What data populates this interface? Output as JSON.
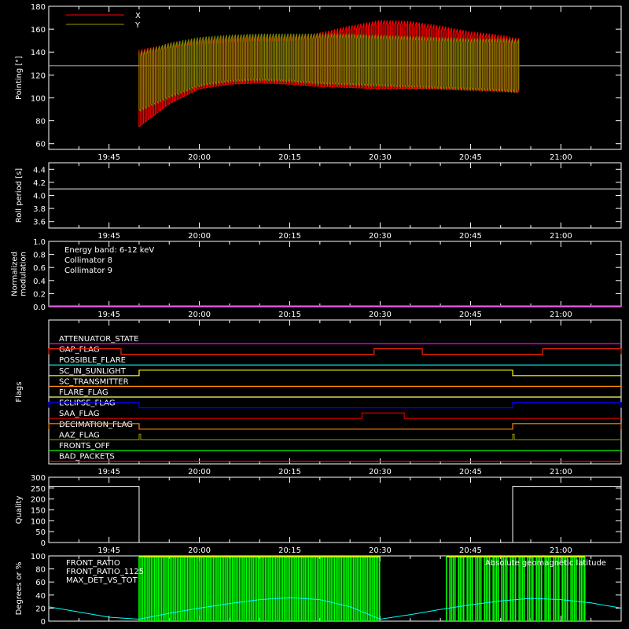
{
  "colors": {
    "background": "#000000",
    "axis": "#ffffff",
    "x_series": "#ff0000",
    "y_series": "#808000"
  },
  "chart_data": [
    {
      "type": "line",
      "ylabel": "Pointing [\"]",
      "ylim": [
        55,
        180
      ],
      "yticks": [
        "60",
        "80",
        "100",
        "120",
        "140",
        "160",
        "180"
      ],
      "xticks": [
        "19:45",
        "20:00",
        "20:15",
        "20:30",
        "20:45",
        "21:00"
      ],
      "xlim": [
        "19:35",
        "21:10"
      ],
      "legend": [
        "X",
        "Y"
      ],
      "legend_colors": [
        "#ff0000",
        "#999900"
      ],
      "reference_line": 128,
      "data_span": [
        "19:50",
        "20:53"
      ],
      "series": [
        {
          "name": "X",
          "color": "#ff0000",
          "time": [
            "19:50",
            "19:55",
            "20:00",
            "20:05",
            "20:10",
            "20:15",
            "20:20",
            "20:25",
            "20:30",
            "20:35",
            "20:40",
            "20:45",
            "20:50",
            "20:53"
          ],
          "upper": [
            142,
            147,
            150,
            152,
            153,
            153,
            157,
            163,
            168,
            167,
            163,
            158,
            155,
            152
          ],
          "lower": [
            75,
            95,
            108,
            112,
            113,
            112,
            110,
            109,
            108,
            108,
            108,
            107,
            106,
            105
          ]
        },
        {
          "name": "Y",
          "color": "#808000",
          "time": [
            "19:50",
            "19:55",
            "20:00",
            "20:05",
            "20:10",
            "20:15",
            "20:20",
            "20:25",
            "20:30",
            "20:35",
            "20:40",
            "20:45",
            "20:50",
            "20:53"
          ],
          "upper": [
            140,
            148,
            153,
            155,
            156,
            156,
            156,
            156,
            155,
            154,
            153,
            152,
            152,
            151
          ],
          "lower": [
            88,
            100,
            110,
            114,
            115,
            114,
            112,
            111,
            110,
            109,
            108,
            107,
            106,
            105
          ]
        }
      ]
    },
    {
      "type": "line",
      "ylabel": "Roll period [s]",
      "ylim": [
        3.5,
        4.5
      ],
      "yticks": [
        "3.6",
        "3.8",
        "4.0",
        "4.2",
        "4.4"
      ],
      "xticks": [
        "19:45",
        "20:00",
        "20:15",
        "20:30",
        "20:45",
        "21:00"
      ],
      "series": [
        {
          "color": "#ffffff",
          "time": [
            "19:35",
            "21:10"
          ],
          "values": [
            4.1,
            4.1
          ]
        }
      ]
    },
    {
      "type": "line",
      "ylabel": "Normalized modulation",
      "ylim": [
        0,
        1.0
      ],
      "yticks": [
        "0.0",
        "0.2",
        "0.4",
        "0.6",
        "0.8",
        "1.0"
      ],
      "xticks": [
        "19:45",
        "20:00",
        "20:15",
        "20:30",
        "20:45",
        "21:00"
      ],
      "annotations": [
        {
          "text": "Energy band: 6-12 keV",
          "color": "#ffffff"
        },
        {
          "text": "Collimator 8",
          "color": "#00ffff"
        },
        {
          "text": "Collimator 9",
          "color": "#ff00ff"
        }
      ],
      "series": [
        {
          "color": "#ff00ff",
          "time": [
            "19:35",
            "21:10"
          ],
          "values": [
            0,
            0
          ]
        }
      ]
    },
    {
      "type": "line",
      "ylabel": "Flags",
      "xticks": [
        "19:45",
        "20:00",
        "20:15",
        "20:30",
        "20:45",
        "21:00"
      ],
      "flags": [
        {
          "name": "ATTENUATOR_STATE",
          "color": "#ff00ff",
          "high": []
        },
        {
          "name": "GAP_FLAG",
          "color": "#ff2200",
          "high": [
            [
              "19:35",
              "19:47"
            ],
            [
              "20:29",
              "20:37"
            ],
            [
              "20:57",
              "21:10"
            ]
          ]
        },
        {
          "name": "POSSIBLE_FLARE",
          "color": "#00ffff",
          "high": []
        },
        {
          "name": "SC_IN_SUNLIGHT",
          "color": "#ffff00",
          "high": [
            [
              "19:50",
              "20:52"
            ]
          ]
        },
        {
          "name": "SC_TRANSMITTER",
          "color": "#ff8800",
          "high": []
        },
        {
          "name": "FLARE_FLAG",
          "color": "#ffff66",
          "high": []
        },
        {
          "name": "ECLIPSE_FLAG",
          "color": "#0000ff",
          "high": [
            [
              "19:35",
              "19:50"
            ],
            [
              "20:52",
              "21:10"
            ]
          ]
        },
        {
          "name": "SAA_FLAG",
          "color": "#dd0000",
          "high": [
            [
              "20:27",
              "20:34"
            ]
          ]
        },
        {
          "name": "DECIMATION_FLAG",
          "color": "#ff8800",
          "high": [
            [
              "19:35",
              "19:50"
            ],
            [
              "20:52",
              "21:10"
            ]
          ]
        },
        {
          "name": "AAZ_FLAG",
          "color": "#808000",
          "high": [
            [
              "19:50",
              "19:50"
            ],
            [
              "20:52",
              "20:52"
            ]
          ]
        },
        {
          "name": "FRONTS_OFF",
          "color": "#00ff00",
          "high": []
        },
        {
          "name": "BAD_PACKETS",
          "color": "#ff0000",
          "high": []
        }
      ]
    },
    {
      "type": "line",
      "ylabel": "Quality",
      "ylim": [
        0,
        300
      ],
      "yticks": [
        "0",
        "50",
        "100",
        "150",
        "200",
        "250",
        "300"
      ],
      "xticks": [
        "19:45",
        "20:00",
        "20:15",
        "20:30",
        "20:45",
        "21:00"
      ],
      "series": [
        {
          "color": "#ffffff",
          "time": [
            "19:35",
            "19:50",
            "19:50",
            "20:52",
            "20:52",
            "21:10"
          ],
          "values": [
            258,
            258,
            0,
            0,
            258,
            258
          ]
        }
      ]
    },
    {
      "type": "line",
      "ylabel": "Degrees or %",
      "ylim": [
        0,
        100
      ],
      "yticks": [
        "0",
        "20",
        "40",
        "60",
        "80",
        "100"
      ],
      "legend": [
        "FRONT_RATIO",
        "FRONT_RATIO_1125",
        "MAX_DET_VS_TOT"
      ],
      "legend_colors": [
        "#ffff00",
        "#00ff00",
        "#ff8800"
      ],
      "right_label": {
        "text": "Absolute geomagnetic latitude",
        "color": "#00ffff"
      },
      "series": [
        {
          "name": "Absolute geomagnetic latitude",
          "color": "#00ffff",
          "time": [
            "19:35",
            "19:40",
            "19:45",
            "19:50",
            "19:55",
            "20:00",
            "20:05",
            "20:10",
            "20:15",
            "20:20",
            "20:25",
            "20:30",
            "20:35",
            "20:40",
            "20:45",
            "20:50",
            "20:55",
            "21:00",
            "21:05",
            "21:10"
          ],
          "values": [
            22,
            14,
            6,
            3,
            12,
            20,
            27,
            33,
            36,
            33,
            22,
            3,
            10,
            18,
            25,
            31,
            35,
            33,
            28,
            20
          ]
        },
        {
          "name": "FRONT_RATIO_1125",
          "color": "#00ff00",
          "time_span": [
            "19:50",
            "20:30"
          ],
          "time_span2": [
            "20:41",
            "21:04"
          ],
          "values_range": [
            0,
            100
          ]
        }
      ]
    }
  ]
}
